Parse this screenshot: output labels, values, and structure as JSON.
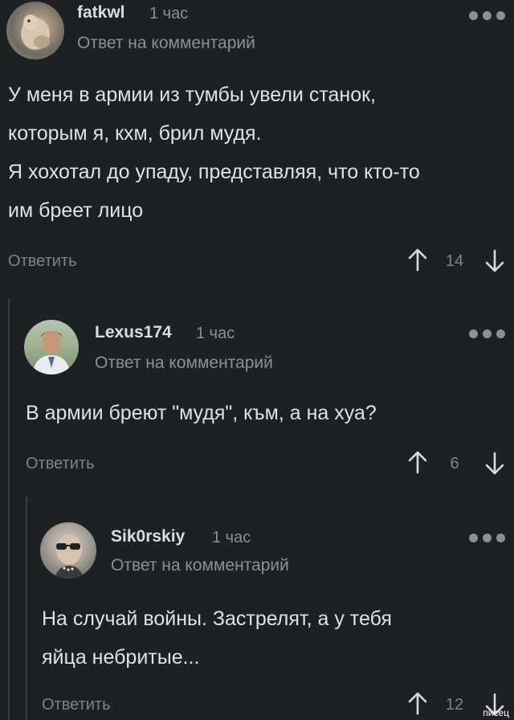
{
  "comments": [
    {
      "username": "fatkwl",
      "time": "1 час",
      "reply_to": "Ответ на комментарий",
      "lines": [
        "У меня в армии из тумбы увели станок,",
        "которым я, кхм, брил мудя.",
        "Я хохотал до упаду, представляя, что кто-то",
        "им бреет лицо"
      ],
      "reply_label": "Ответить",
      "votes": "14",
      "avatar_icon": "cat-photo-avatar"
    },
    {
      "username": "Lexus174",
      "time": "1 час",
      "reply_to": "Ответ на комментарий",
      "lines": [
        "В армии бреют \"мудя\", към, а на хуа?"
      ],
      "reply_label": "Ответить",
      "votes": "6",
      "avatar_icon": "man-photo-avatar"
    },
    {
      "username": "Sik0rskiy",
      "time": "1 час",
      "reply_to": "Ответ на комментарий",
      "lines": [
        "На случай войны. Застрелят, а у тебя",
        "яйца небритые..."
      ],
      "reply_label": "Ответить",
      "votes": "12",
      "avatar_icon": "sunglasses-man-avatar"
    }
  ],
  "watermark": "писец",
  "colors": {
    "background": "#1d2124",
    "text": "#dfe2e4",
    "muted": "#8a9095",
    "thread_line": "#3a3f43"
  }
}
